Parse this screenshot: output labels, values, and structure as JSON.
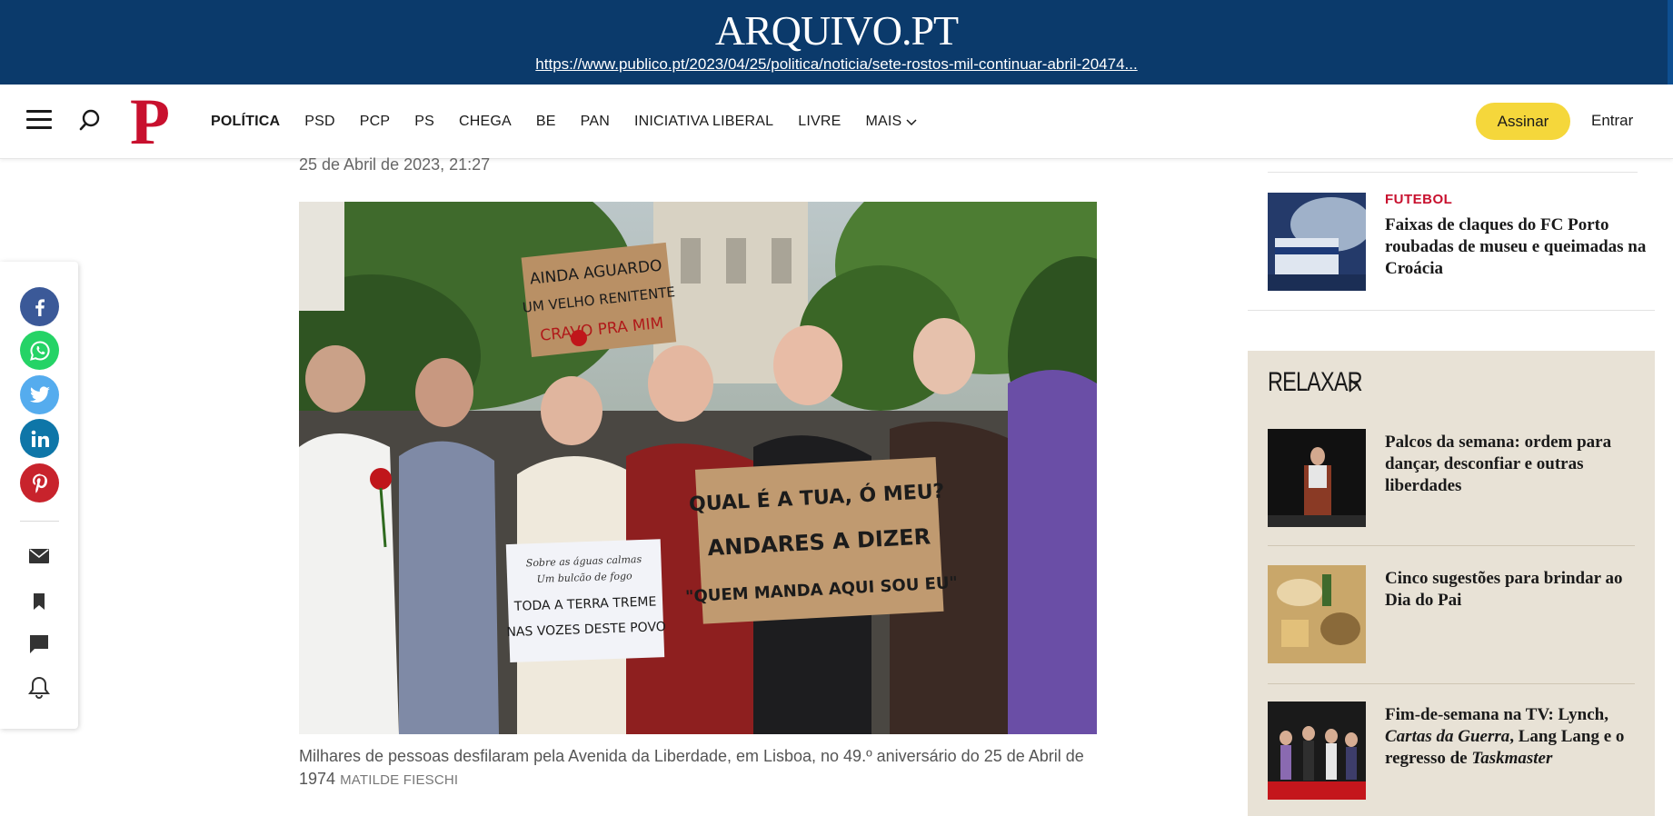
{
  "arquivo": {
    "logo": "ARQUIVO.PT",
    "url": "https://www.publico.pt/2023/04/25/politica/noticia/sete-rostos-mil-continuar-abril-20474..."
  },
  "header": {
    "brand": "P",
    "nav": [
      "POLÍTICA",
      "PSD",
      "PCP",
      "PS",
      "CHEGA",
      "BE",
      "PAN",
      "INICIATIVA LIBERAL",
      "LIVRE"
    ],
    "more_label": "MAIS",
    "subscribe_label": "Assinar",
    "login_label": "Entrar"
  },
  "article": {
    "date": "25 de Abril de 2023, 21:27",
    "caption": "Milhares de pessoas desfilaram pela Avenida da Liberdade, em Lisboa, no 49.º aniversário do 25 de Abril de 1974",
    "credit": "MATILDE FIESCHI",
    "image_signs": {
      "top_line1": "AINDA AGUARDO",
      "top_line2": "UM VELHO RENITENTE",
      "top_line3": "CRAVO PRA MIM",
      "center_line1": "QUAL É A TUA, Ó MEU?",
      "center_line2": "ANDARES A DIZER",
      "center_line3": "\"QUEM MANDA AQUI SOU EU\"",
      "left_line1": "Sobre as águas calmas",
      "left_line2": "Um bulcão de fogo",
      "left_line3": "TODA A TERRA TREME",
      "left_line4": "NAS VOZES DESTE POVO"
    }
  },
  "sidebar": {
    "related": {
      "tag": "FUTEBOL",
      "headline": "Faixas de claques do FC Porto roubadas de museu e queimadas na Croácia"
    },
    "relax": {
      "title": "RELAXAR",
      "items": [
        {
          "headline": "Palcos da semana: ordem para dançar, desconfiar e outras liberdades"
        },
        {
          "headline": "Cinco sugestões para brindar ao Dia do Pai"
        },
        {
          "headline_a": "Fim-de-semana na TV: Lynch, ",
          "headline_b": "Cartas da Guerra",
          "headline_c": ", Lang Lang e o regresso de ",
          "headline_d": "Taskmaster"
        }
      ]
    }
  },
  "colors": {
    "arquivo_blue": "#0b3a6b",
    "brand_red": "#c8102e",
    "subscribe_yellow": "#f5d73b",
    "relax_bg": "#e8e2d6",
    "facebook": "#3b5998",
    "whatsapp": "#25d366",
    "twitter": "#55acee",
    "linkedin": "#0e76a8",
    "pinterest": "#c8232c"
  },
  "icons": {
    "share": [
      "facebook-icon",
      "whatsapp-icon",
      "twitter-icon",
      "linkedin-icon",
      "pinterest-icon"
    ],
    "tools": [
      "email-icon",
      "bookmark-icon",
      "comment-icon",
      "bell-icon"
    ]
  }
}
